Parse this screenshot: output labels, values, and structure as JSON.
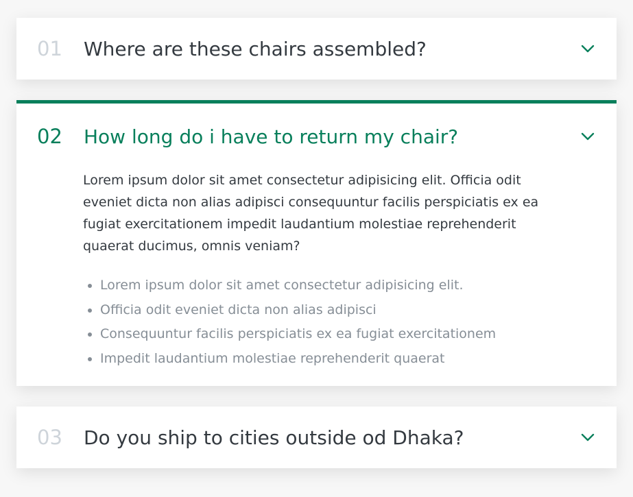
{
  "accent_color": "#087f5b",
  "faq": {
    "items": [
      {
        "number": "01",
        "question": "Where are these chairs assembled?",
        "open": false
      },
      {
        "number": "02",
        "question": "How long do i have to return my chair?",
        "open": true,
        "answer": "Lorem ipsum dolor sit amet consectetur adipisicing elit. Officia odit eveniet dicta non alias adipisci consequuntur facilis perspiciatis ex ea fugiat exercitationem impedit laudantium molestiae reprehenderit quaerat ducimus, omnis veniam?",
        "bullets": [
          "Lorem ipsum dolor sit amet consectetur adipisicing elit.",
          "Officia odit eveniet dicta non alias adipisci",
          "Consequuntur facilis perspiciatis ex ea fugiat exercitationem",
          "Impedit laudantium molestiae reprehenderit quaerat"
        ]
      },
      {
        "number": "03",
        "question": "Do you ship to cities outside od Dhaka?",
        "open": false
      }
    ],
    "icon": "chevron-down-icon"
  }
}
